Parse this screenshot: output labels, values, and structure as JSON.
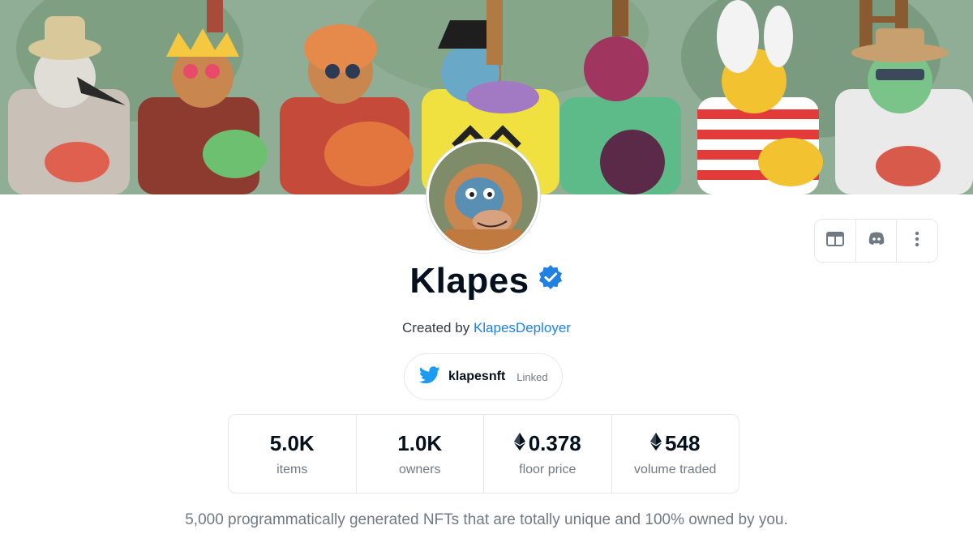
{
  "collection": {
    "name": "Klapes",
    "created_by_prefix": "Created by",
    "creator": "KlapesDeployer",
    "twitter_handle": "klapesnft",
    "twitter_status": "Linked",
    "description": "5,000 programmatically generated NFTs that are totally unique and 100% owned by you."
  },
  "stats": [
    {
      "value": "5.0K",
      "label": "items",
      "eth": false
    },
    {
      "value": "1.0K",
      "label": "owners",
      "eth": false
    },
    {
      "value": "0.378",
      "label": "floor price",
      "eth": true
    },
    {
      "value": "548",
      "label": "volume traded",
      "eth": true
    }
  ],
  "actions": [
    {
      "icon": "website-icon"
    },
    {
      "icon": "discord-icon"
    },
    {
      "icon": "more-options-icon"
    }
  ],
  "colors": {
    "link": "#2081e2",
    "verified": "#2081e2",
    "twitter": "#1d9bf0",
    "text": "#04111d",
    "muted": "#707a83",
    "border": "#e5e8eb"
  }
}
